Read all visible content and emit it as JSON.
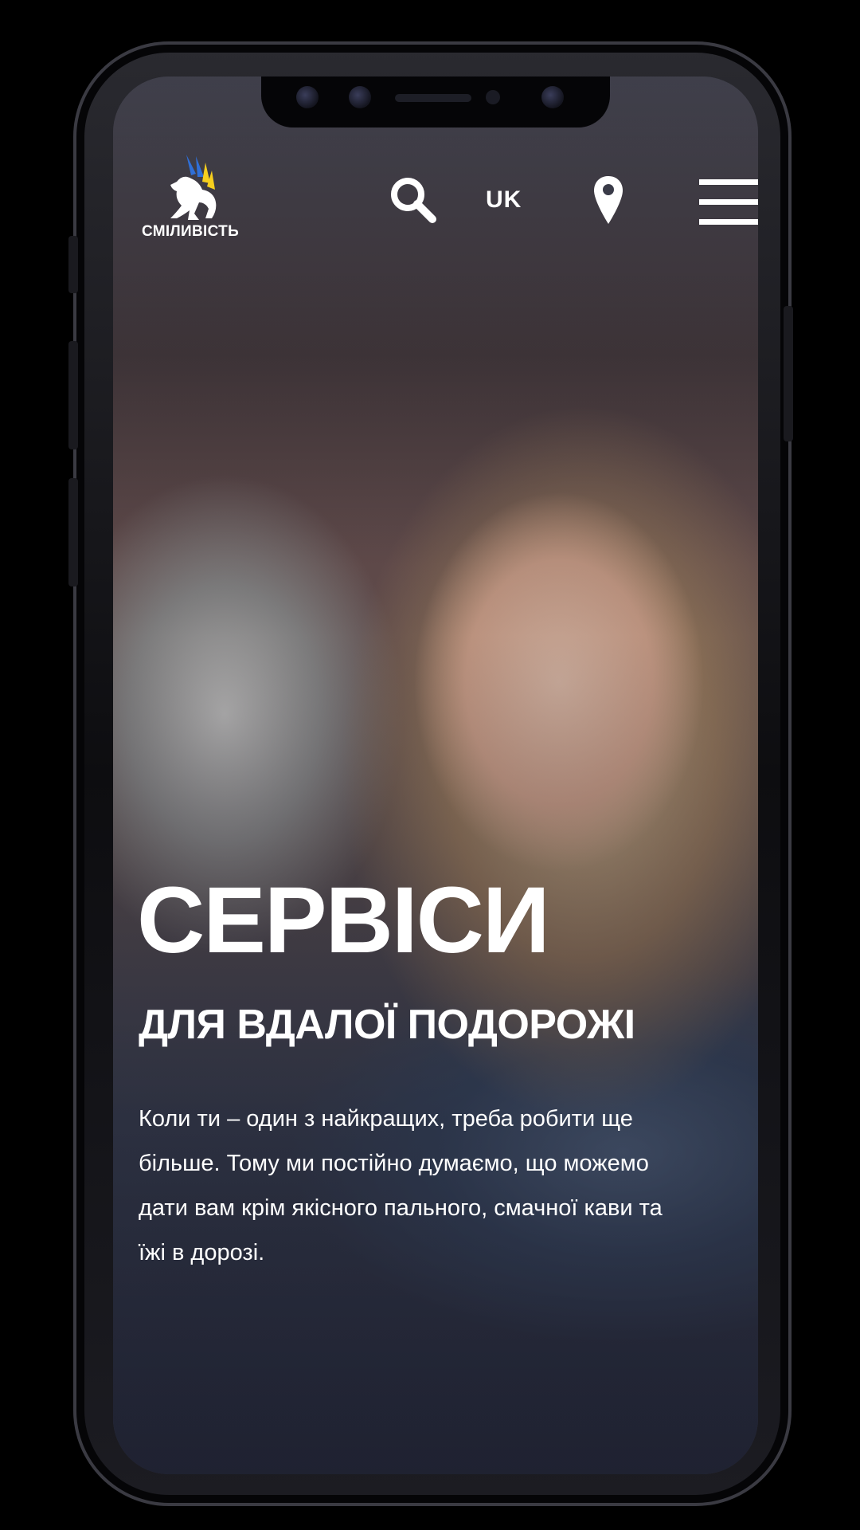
{
  "brand": {
    "name": "СМІЛИВІСТЬ",
    "logo_icon": "griffin-logo-icon",
    "colors": {
      "blue": "#2f6fd6",
      "yellow": "#f6cf1e",
      "white": "#ffffff"
    }
  },
  "header": {
    "search_icon": "search-icon",
    "language": "UK",
    "location_icon": "location-pin-icon",
    "menu_icon": "hamburger-menu-icon"
  },
  "hero": {
    "title": "СЕРВІСИ",
    "subtitle": "ДЛЯ ВДАЛОЇ ПОДОРОЖІ",
    "body_lines": [
      "Коли ти – один з найкращих, треба робити ще",
      "більше. Тому ми постійно думаємо, що можемо",
      "дати вам крім якісного пального, смачної кави та",
      "їжі в дорозі."
    ]
  }
}
